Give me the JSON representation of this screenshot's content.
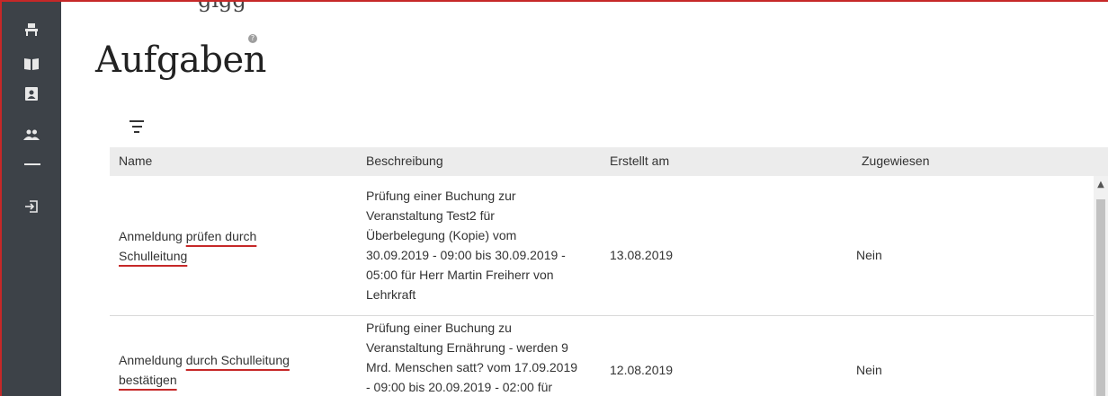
{
  "sidebar": {
    "items": [
      {
        "icon": "desk-icon",
        "label": ""
      },
      {
        "icon": "book-icon",
        "label": ""
      },
      {
        "icon": "contact-card-icon",
        "label": ""
      },
      {
        "icon": "people-icon",
        "label": ""
      },
      {
        "icon": "logout-icon",
        "label": ""
      }
    ]
  },
  "page": {
    "cropped_heading": "gigg",
    "title": "Aufgaben",
    "help_glyph": "?"
  },
  "table": {
    "columns": [
      "Name",
      "Beschreibung",
      "Erstellt am",
      "Zugewiesen"
    ],
    "rows": [
      {
        "name_plain": "Anmeldung ",
        "name_underlined_1": "prüfen durch",
        "name_underlined_2": "Schulleitung",
        "description_lines": [
          "Prüfung einer Buchung zur",
          "Veranstaltung Test2 für",
          "Überbelegung (Kopie) vom",
          "30.09.2019 - 09:00 bis 30.09.2019 -",
          "05:00 für Herr Martin Freiherr von",
          "Lehrkraft"
        ],
        "created": "13.08.2019",
        "assigned": "Nein"
      },
      {
        "name_plain": "Anmeldung ",
        "name_underlined_1": "durch Schulleitung",
        "name_underlined_2": "bestätigen",
        "description_lines": [
          "Prüfung einer Buchung zu",
          "Veranstaltung Ernährung - werden 9",
          "Mrd. Menschen satt? vom 17.09.2019",
          "- 09:00 bis 20.09.2019 - 02:00 für"
        ],
        "created": "12.08.2019",
        "assigned": "Nein"
      }
    ]
  },
  "colors": {
    "sidebar_bg": "#3d4248",
    "header_bg": "#ececec",
    "accent_red": "#c62828"
  }
}
